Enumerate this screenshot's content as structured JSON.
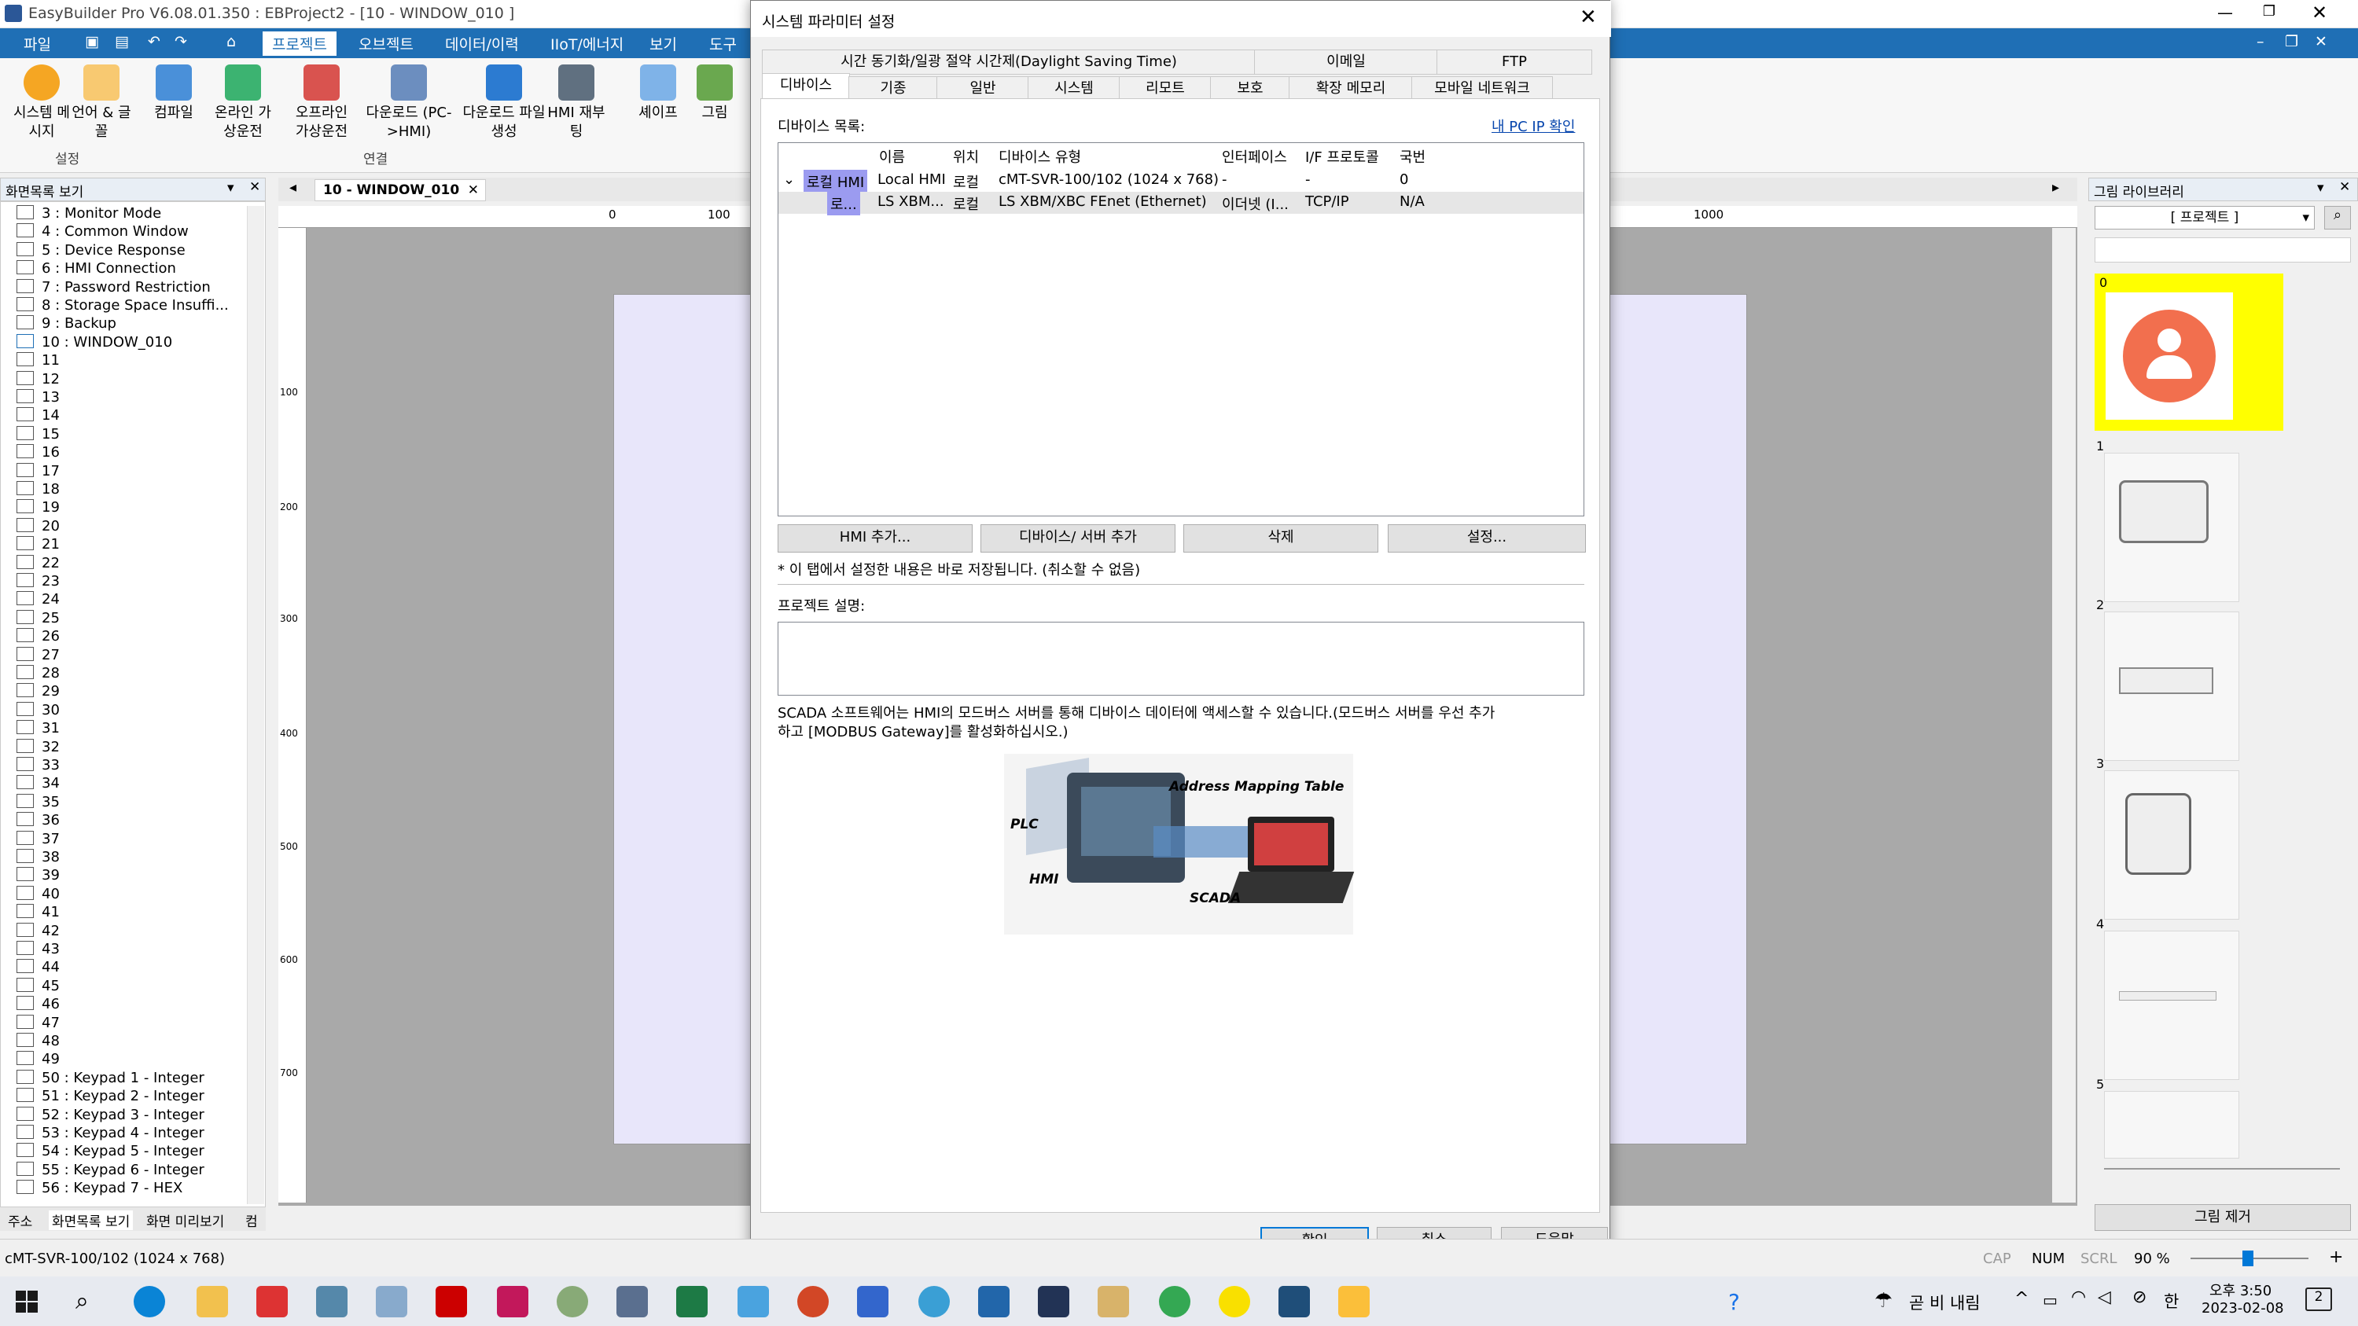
{
  "app": {
    "title": "EasyBuilder Pro V6.08.01.350 : EBProject2 - [10 - WINDOW_010 ]"
  },
  "menu": [
    "파일",
    "프로젝트",
    "오브젝트",
    "데이터/이력",
    "IIoT/에너지",
    "보기",
    "도구"
  ],
  "ribbon": {
    "buttons": [
      "시스템 메시지",
      "언어 & 글꼴",
      "컴파일",
      "온라인 가상운전",
      "오프라인 가상운전",
      "다운로드 (PC->HMI)",
      "다운로드 파일 생성",
      "HMI 재부팅",
      "셰이프",
      "그림"
    ],
    "groups": [
      "설정",
      "연결"
    ]
  },
  "window_list": {
    "title": "화면목록 보기",
    "items": [
      "3 : Monitor Mode",
      "4 : Common Window",
      "5 : Device Response",
      "6 : HMI Connection",
      "7 : Password Restriction",
      "8 : Storage Space Insuffi...",
      "9 : Backup",
      "10 : WINDOW_010",
      "11",
      "12",
      "13",
      "14",
      "15",
      "16",
      "17",
      "18",
      "19",
      "20",
      "21",
      "22",
      "23",
      "24",
      "25",
      "26",
      "27",
      "28",
      "29",
      "30",
      "31",
      "32",
      "33",
      "34",
      "35",
      "36",
      "37",
      "38",
      "39",
      "40",
      "41",
      "42",
      "43",
      "44",
      "45",
      "46",
      "47",
      "48",
      "49",
      "50 : Keypad 1 - Integer",
      "51 : Keypad 2 - Integer",
      "52 : Keypad 3 - Integer",
      "53 : Keypad 4 - Integer",
      "54 : Keypad 5 - Integer",
      "55 : Keypad 6 - Integer",
      "56 : Keypad 7 - HEX"
    ],
    "bottom_tabs": [
      "주소",
      "화면목록 보기",
      "화면 미리보기",
      "컴"
    ]
  },
  "editor": {
    "tab": "10 - WINDOW_010",
    "ruler_marks": [
      "0",
      "100",
      "1000"
    ],
    "vruler": [
      "100",
      "200",
      "300",
      "400",
      "500",
      "600",
      "700"
    ]
  },
  "dialog": {
    "title": "시스템 파라미터 설정",
    "tabs_row1": [
      "시간 동기화/일광 절약 시간제(Daylight Saving Time)",
      "이메일",
      "FTP"
    ],
    "tabs_row2": [
      "디바이스",
      "기종",
      "일반",
      "시스템",
      "리모트",
      "보호",
      "확장 메모리",
      "모바일 네트워크"
    ],
    "device_list_label": "디바이스 목록:",
    "ip_link": "내 PC IP 확인",
    "columns": [
      "이름",
      "위치",
      "디바이스 유형",
      "인터페이스",
      "I/F 프로토콜",
      "국번"
    ],
    "rows": [
      [
        "로컬 HMI",
        "Local HMI",
        "로컬",
        "cMT-SVR-100/102 (1024 x 768)",
        "-",
        "-",
        "0"
      ],
      [
        "로...",
        "LS XBM...",
        "로컬",
        "LS XBM/XBC FEnet (Ethernet)",
        "이더넷 (I...",
        "TCP/IP",
        "N/A"
      ]
    ],
    "buttons": [
      "HMI 추가...",
      "디바이스/ 서버 추가",
      "삭제",
      "설정..."
    ],
    "note": "* 이 탭에서 설정한 내용은 바로 저장됩니다. (취소할 수 없음)",
    "desc_label": "프로젝트 설명:",
    "scada_text1": "SCADA 소프트웨어는 HMI의 모드버스 서버를 통해 디바이스 데이터에 액세스할 수 있습니다.(모드버스 서버를 우선 추가",
    "scada_text2": "하고 [MODBUS Gateway]를 활성화하십시오.)",
    "image_labels": [
      "Address Mapping Table",
      "PLC",
      "HMI",
      "SCADA"
    ],
    "ok": "확인",
    "cancel": "취소",
    "help": "도움말"
  },
  "library": {
    "title": "그림 라이브러리",
    "dropdown": "[ 프로젝트 ]",
    "items": [
      "0",
      "1",
      "2",
      "3",
      "4",
      "5"
    ],
    "remove": "그림 제거"
  },
  "status": {
    "model": "cMT-SVR-100/102 (1024 x 768)",
    "cap": "CAP",
    "num": "NUM",
    "scrl": "SCRL",
    "zoom": "90 %"
  },
  "taskbar": {
    "weather": "곧 비 내림",
    "ime": "한",
    "time": "오후 3:50",
    "date": "2023-02-08",
    "notif": "2"
  },
  "colors": {
    "accent": "#1f6fb5",
    "select_yellow": "#ffff00",
    "avatar": "#f26f4e"
  }
}
